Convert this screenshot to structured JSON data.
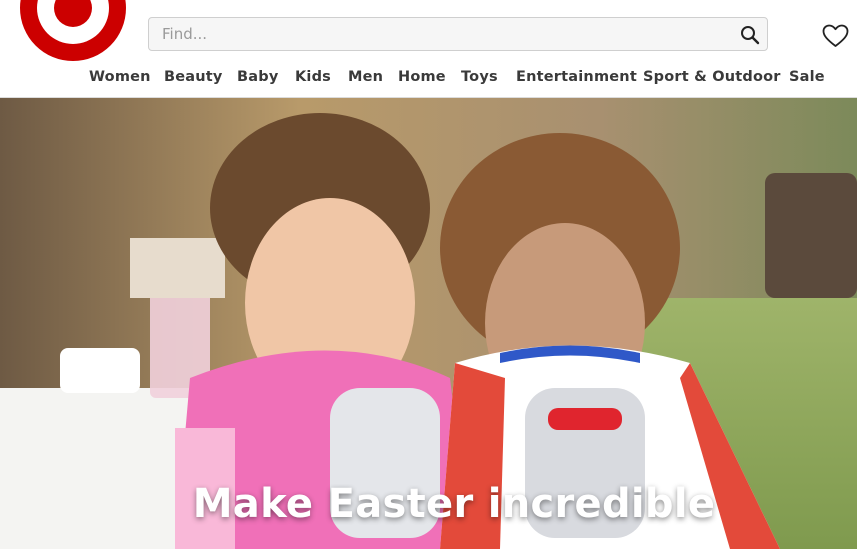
{
  "brand": {
    "logo_icon": "target-bullseye-logo",
    "color": "#cc0000"
  },
  "search": {
    "placeholder": "Find...",
    "value": "",
    "icon": "search-icon"
  },
  "header": {
    "wishlist_icon": "heart-icon"
  },
  "nav": {
    "items": [
      {
        "label": "Women"
      },
      {
        "label": "Beauty"
      },
      {
        "label": "Baby"
      },
      {
        "label": "Kids"
      },
      {
        "label": "Men"
      },
      {
        "label": "Home"
      },
      {
        "label": "Toys"
      },
      {
        "label": "Entertainment"
      },
      {
        "label": "Sport & Outdoor"
      },
      {
        "label": "Sale"
      }
    ]
  },
  "hero": {
    "title": "Make Easter incredible"
  },
  "colors": {
    "accent": "#cc0000",
    "active_tab": "#3d8fe0"
  }
}
